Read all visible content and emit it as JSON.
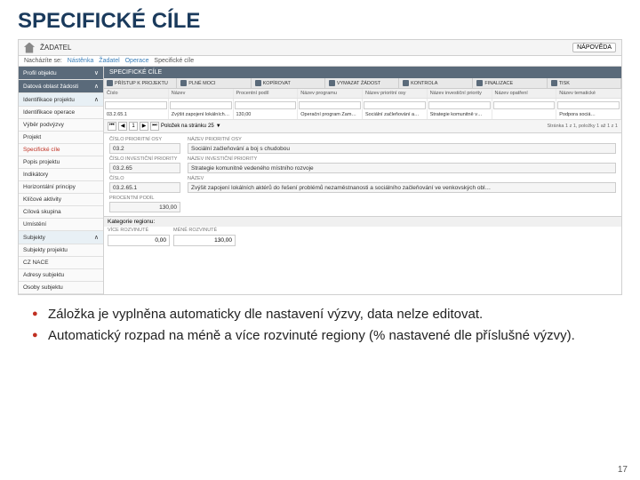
{
  "slide": {
    "title": "SPECIFICKÉ CÍLE",
    "pagenum": "17"
  },
  "topbar": {
    "crumb": "ŽADATEL",
    "help": "NÁPOVĚDA"
  },
  "breadcrumb": {
    "label": "Nacházíte se:",
    "items": [
      "Nástěnka",
      "Žadatel",
      "Operace",
      "Specifické cíle"
    ]
  },
  "sidebar": {
    "items": [
      {
        "label": "Profil objektu",
        "glyph": "∨",
        "cls": "dark"
      },
      {
        "label": "Datová oblast žádosti",
        "glyph": "∧",
        "cls": "dark"
      },
      {
        "label": "Identifikace projektu",
        "glyph": "∧",
        "cls": "light"
      },
      {
        "label": "Identifikace operace",
        "glyph": "",
        "cls": ""
      },
      {
        "label": "Výběr podvýzvy",
        "glyph": "",
        "cls": ""
      },
      {
        "label": "Projekt",
        "glyph": "",
        "cls": ""
      },
      {
        "label": "Specifické cíle",
        "glyph": "",
        "cls": "active"
      },
      {
        "label": "Popis projektu",
        "glyph": "",
        "cls": ""
      },
      {
        "label": "Indikátory",
        "glyph": "",
        "cls": ""
      },
      {
        "label": "Horizontální principy",
        "glyph": "",
        "cls": ""
      },
      {
        "label": "Klíčové aktivity",
        "glyph": "",
        "cls": ""
      },
      {
        "label": "Cílová skupina",
        "glyph": "",
        "cls": ""
      },
      {
        "label": "Umístění",
        "glyph": "",
        "cls": ""
      },
      {
        "label": "Subjekty",
        "glyph": "∧",
        "cls": "light"
      },
      {
        "label": "Subjekty projektu",
        "glyph": "",
        "cls": ""
      },
      {
        "label": "CZ NACE",
        "glyph": "",
        "cls": ""
      },
      {
        "label": "Adresy subjektu",
        "glyph": "",
        "cls": ""
      },
      {
        "label": "Osoby subjektu",
        "glyph": "",
        "cls": ""
      }
    ]
  },
  "panel": {
    "title": "SPECIFICKÉ CÍLE"
  },
  "toolbar": {
    "buttons": [
      {
        "label": "PŘÍSTUP K PROJEKTU"
      },
      {
        "label": "PLNÉ MOCI"
      },
      {
        "label": "KOPÍROVAT"
      },
      {
        "label": "VYMAZAT ŽÁDOST"
      },
      {
        "label": "KONTROLA"
      },
      {
        "label": "FINALIZACE"
      },
      {
        "label": "TISK"
      }
    ]
  },
  "grid": {
    "headers": [
      "Číslo",
      "Název",
      "Procentní podíl",
      "Název programu",
      "Název prioritní osy",
      "Název investiční priority",
      "Název opatření",
      "Název tematické"
    ],
    "row": [
      "03.2.65.1",
      "Zvýšit zapojení lokálních akt…",
      "130,00",
      "Operační program Zam…",
      "Sociální začleňování a…",
      "Strategie komunitně v…",
      "",
      "Podpora sociá…"
    ]
  },
  "pager": {
    "label": "Položek na stránku",
    "size": "25",
    "status": "Stránka 1 z 1, položky 1 až 1 z 1"
  },
  "form": {
    "cislo_po_label": "ČÍSLO PRIORITNÍ OSY",
    "cislo_po": "03.2",
    "nazev_po_label": "NÁZEV PRIORITNÍ OSY",
    "nazev_po": "Sociální začleňování a boj s chudobou",
    "cislo_ip_label": "ČÍSLO INVESTIČNÍ PRIORITY",
    "cislo_ip": "03.2.65",
    "nazev_ip_label": "NÁZEV INVESTIČNÍ PRIORITY",
    "nazev_ip": "Strategie komunitně vedeného místního rozvoje",
    "cislo_label": "ČÍSLO",
    "cislo": "03.2.65.1",
    "nazev_label": "NÁZEV",
    "nazev": "Zvýšit zapojení lokálních aktérů do řešení problémů nezaměstnanosti a sociálního začleňování ve venkovských obl…",
    "procent_label": "PROCENTNÍ PODÍL",
    "procent": "130,00",
    "kategorie": "Kategorie regionu:",
    "reg_vice_label": "VÍCE ROZVINUTÉ",
    "reg_vice": "0,00",
    "reg_mene_label": "MÉNĚ ROZVINUTÉ",
    "reg_mene": "130,00"
  },
  "bullets": {
    "b1": "Záložka je vyplněna automaticky dle nastavení výzvy, data nelze editovat.",
    "b2": "Automatický rozpad na méně a více rozvinuté regiony (% nastavené dle příslušné výzvy)."
  }
}
